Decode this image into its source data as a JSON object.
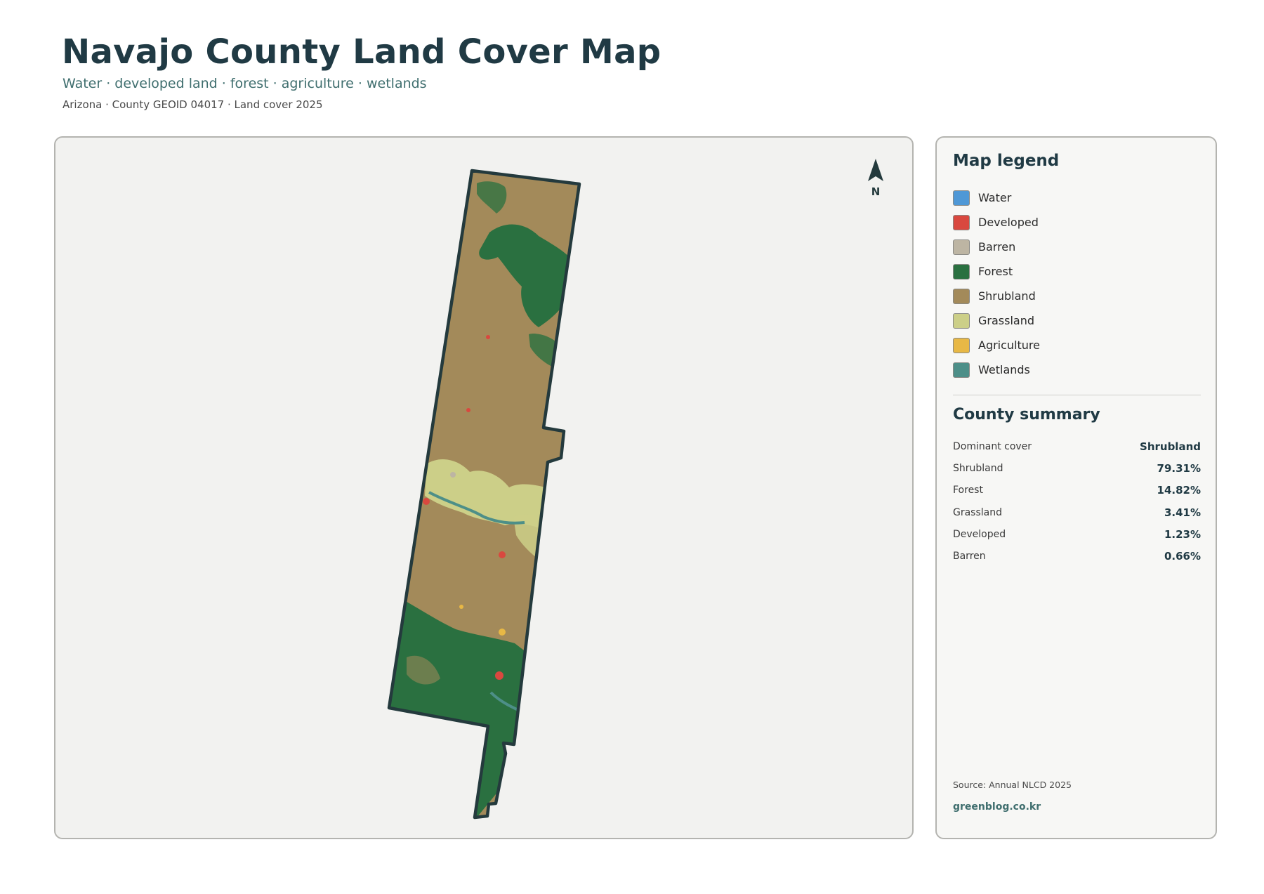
{
  "header": {
    "title": "Navajo County Land Cover Map",
    "subtitle": "Water · developed land · forest · agriculture · wetlands",
    "meta": "Arizona · County GEOID 04017 · Land cover 2025"
  },
  "map": {
    "north_label": "N",
    "north_icon": "north-arrow-icon",
    "colors": {
      "water": "#4f98d6",
      "developed": "#d9483f",
      "barren": "#bdb5a3",
      "forest": "#2a7040",
      "shrubland": "#a38a5a",
      "grassland": "#cccf88",
      "agriculture": "#e8b845",
      "wetlands": "#4d8f88",
      "boundary": "#243a3d",
      "background": "#f2f2f0"
    }
  },
  "legend": {
    "title": "Map legend",
    "items": [
      {
        "label": "Water",
        "color": "#4f98d6"
      },
      {
        "label": "Developed",
        "color": "#d9483f"
      },
      {
        "label": "Barren",
        "color": "#bdb5a3"
      },
      {
        "label": "Forest",
        "color": "#2a7040"
      },
      {
        "label": "Shrubland",
        "color": "#a38a5a"
      },
      {
        "label": "Grassland",
        "color": "#cccf88"
      },
      {
        "label": "Agriculture",
        "color": "#e8b845"
      },
      {
        "label": "Wetlands",
        "color": "#4d8f88"
      }
    ]
  },
  "summary": {
    "title": "County summary",
    "rows": [
      {
        "label": "Dominant cover",
        "value": "Shrubland"
      },
      {
        "label": "Shrubland",
        "value": "79.31%"
      },
      {
        "label": "Forest",
        "value": "14.82%"
      },
      {
        "label": "Grassland",
        "value": "3.41%"
      },
      {
        "label": "Developed",
        "value": "1.23%"
      },
      {
        "label": "Barren",
        "value": "0.66%"
      }
    ]
  },
  "footer": {
    "source": "Source: Annual NLCD 2025",
    "credit": "greenblog.co.kr"
  }
}
